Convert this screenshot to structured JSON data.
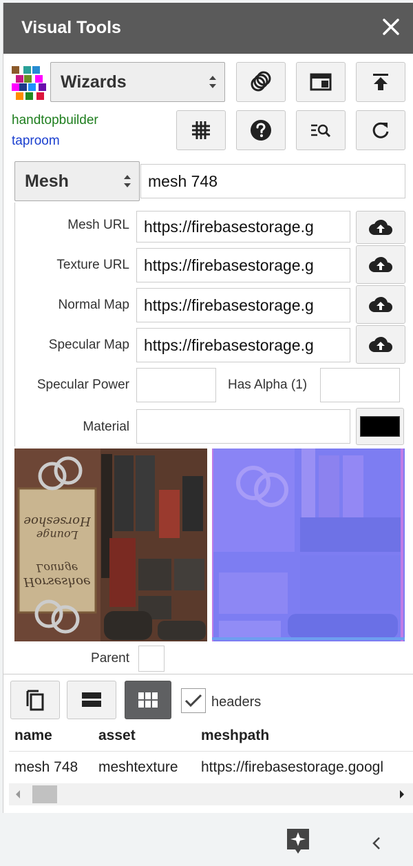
{
  "titlebar": {
    "title": "Visual Tools"
  },
  "wizards_select": {
    "value": "Wizards"
  },
  "links": {
    "link1": "handtopbuilder",
    "link2": "taproom"
  },
  "mesh_select": {
    "value": "Mesh"
  },
  "mesh_name": {
    "value": "mesh 748"
  },
  "fields": {
    "mesh_url": {
      "label": "Mesh URL",
      "value": "https://firebasestorage.g"
    },
    "texture_url": {
      "label": "Texture URL",
      "value": "https://firebasestorage.g"
    },
    "normal_map": {
      "label": "Normal Map",
      "value": "https://firebasestorage.g"
    },
    "specular_map": {
      "label": "Specular Map",
      "value": "https://firebasestorage.g"
    },
    "specular_power": {
      "label": "Specular Power",
      "value": ""
    },
    "has_alpha": {
      "label": "Has Alpha (1)",
      "value": ""
    },
    "material": {
      "label": "Material",
      "value": "",
      "color": "#000000"
    },
    "parent": {
      "label": "Parent",
      "value": ""
    }
  },
  "texture_sign": {
    "line1": "Horseshoe",
    "line2": "Lounge"
  },
  "table": {
    "headers_toggle_label": "headers",
    "headers_checked": true,
    "columns": [
      "name",
      "asset",
      "meshpath"
    ],
    "rows": [
      [
        "mesh 748",
        "meshtexture",
        "https://firebasestorage.googl"
      ]
    ]
  },
  "colors": {
    "titlebar": "#5a5a5a",
    "link1": "#1e7e1e",
    "link2": "#1a3fcf",
    "normal_map_base": "#8080f0"
  }
}
